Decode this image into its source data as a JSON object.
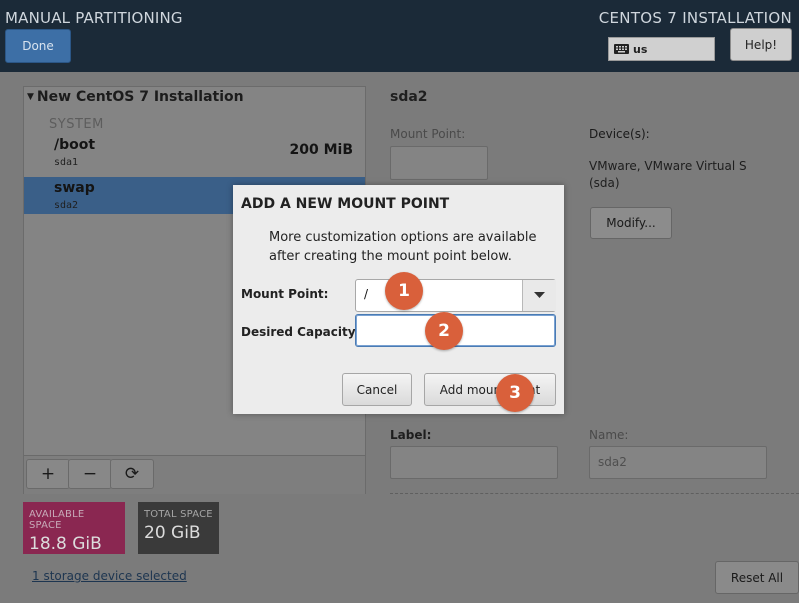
{
  "header": {
    "title": "MANUAL PARTITIONING",
    "product": "CENTOS 7 INSTALLATION",
    "done_label": "Done",
    "keyboard_layout": "us",
    "help_label": "Help!"
  },
  "left_panel": {
    "install_title": "New CentOS 7 Installation",
    "group_label": "SYSTEM",
    "partitions": [
      {
        "mount": "/boot",
        "device": "sda1",
        "size": "200 MiB"
      },
      {
        "mount": "swap",
        "device": "sda2",
        "size": ""
      }
    ],
    "toolbar": {
      "add": "+",
      "remove": "−",
      "refresh": "⟳"
    },
    "available_space": {
      "label": "AVAILABLE SPACE",
      "value": "18.8 GiB"
    },
    "total_space": {
      "label": "TOTAL SPACE",
      "value": "20 GiB"
    },
    "storage_link": "1 storage device selected"
  },
  "right_panel": {
    "device_heading": "sda2",
    "mount_point_label": "Mount Point:",
    "devices_label": "Device(s):",
    "device_desc_line1": "VMware, VMware Virtual S",
    "device_desc_line2": "(sda)",
    "modify_label": "Modify...",
    "label_label": "Label:",
    "name_label": "Name:",
    "name_placeholder": "sda2",
    "reset_label": "Reset All"
  },
  "dialog": {
    "title": "ADD A NEW MOUNT POINT",
    "message_line1": "More customization options are available",
    "message_line2": "after creating the mount point below.",
    "mount_point_label": "Mount Point:",
    "mount_point_value": "/",
    "capacity_label": "Desired Capacity:",
    "capacity_value": "",
    "cancel_label": "Cancel",
    "add_label": "Add mount point"
  },
  "markers": [
    "1",
    "2",
    "3"
  ],
  "colors": {
    "header_bg": "#1b2a38",
    "selection": "#3a5f88",
    "available_space": "#8a2751",
    "marker": "#d9603b"
  }
}
